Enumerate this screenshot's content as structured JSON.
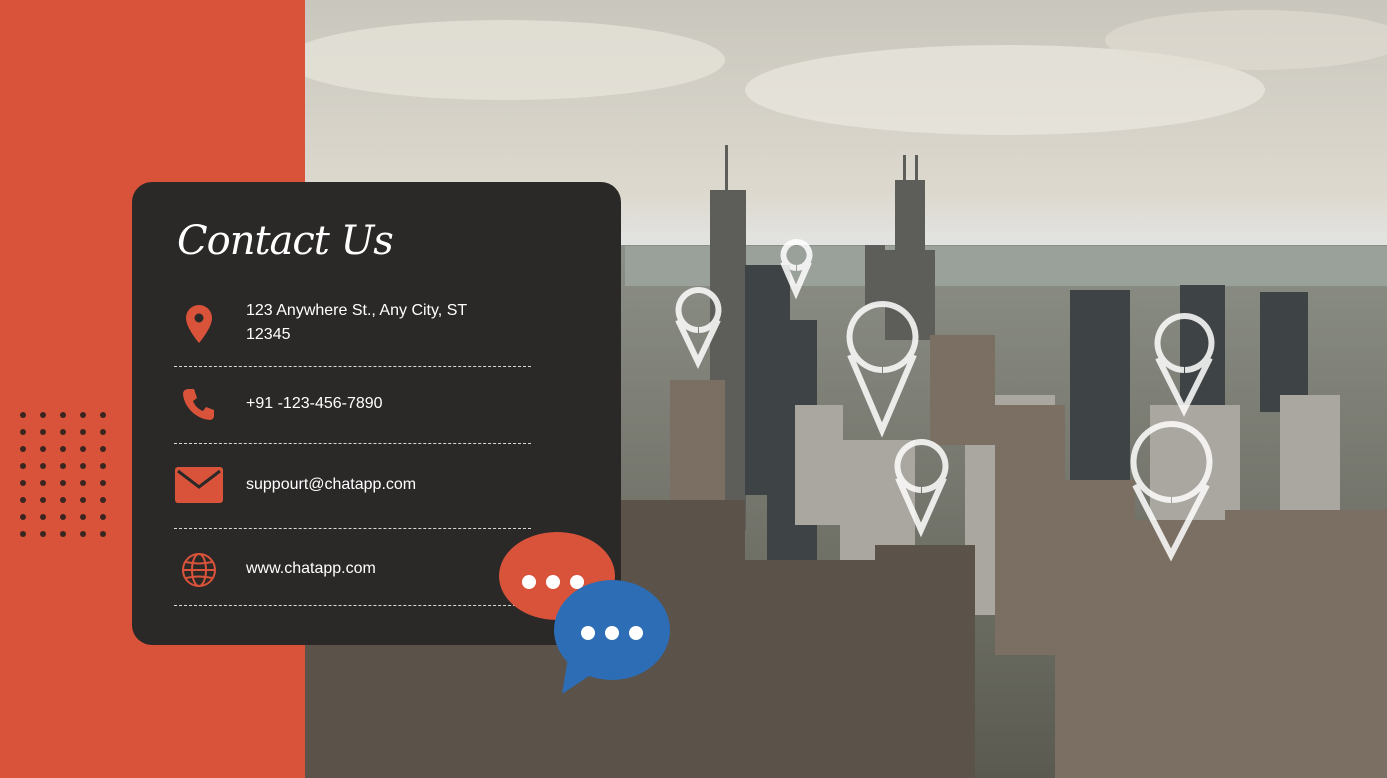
{
  "card": {
    "title": "Contact Us",
    "address": "123 Anywhere St., Any City, ST 12345",
    "phone": "+91 -123-456-7890",
    "email": "suppourt@chatapp.com",
    "website": "www.chatapp.com"
  },
  "icons": {
    "address": "location-pin-icon",
    "phone": "phone-icon",
    "email": "envelope-icon",
    "website": "globe-icon",
    "chat_orange": "chat-bubble-icon",
    "chat_blue": "chat-bubble-icon"
  },
  "colors": {
    "accent": "#d9533a",
    "card": "#2b2928",
    "chat_blue": "#2d6db5",
    "dots": "#3a2620"
  }
}
